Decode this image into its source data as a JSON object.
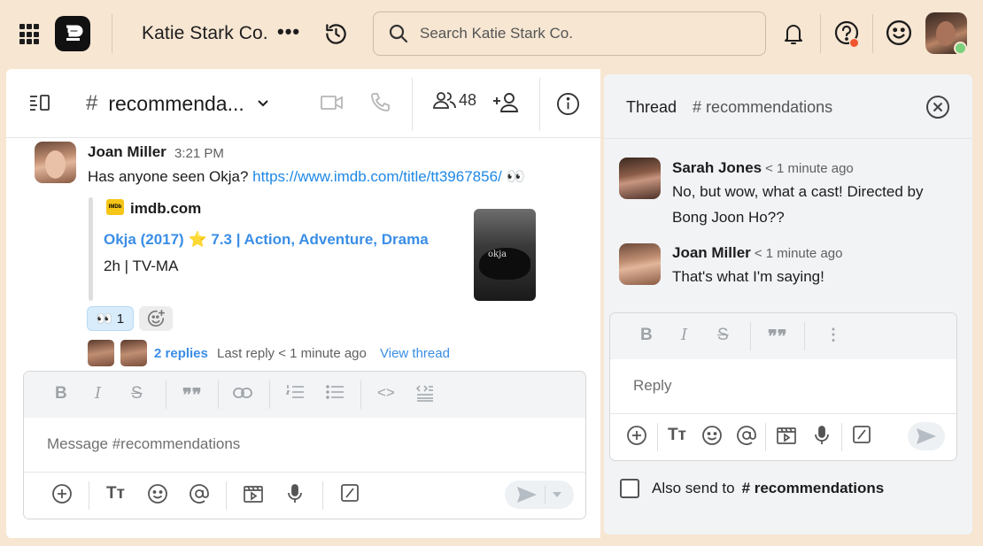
{
  "topbar": {
    "workspace_name": "Katie Stark Co.",
    "more_label": "•••",
    "search_placeholder": "Search Katie Stark Co."
  },
  "channel": {
    "hash": "#",
    "name": "recommenda...",
    "member_count": "48"
  },
  "message": {
    "author": "Joan Miller",
    "time": "3:21 PM",
    "text": "Has anyone seen Okja? ",
    "link": "https://www.imdb.com/title/tt3967856/",
    "emoji": " 👀",
    "preview": {
      "badge": "IMDb",
      "site": "imdb.com",
      "title": "Okja (2017) ⭐ 7.3 | Action, Adventure, Drama",
      "meta": "2h | TV-MA",
      "poster_title": "okja"
    },
    "reaction": {
      "emoji": "👀",
      "count": "1"
    },
    "replies": {
      "count_label": "2 replies",
      "last_reply": "Last reply < 1 minute ago",
      "view_thread": "View thread"
    }
  },
  "composer": {
    "placeholder": "Message #recommendations"
  },
  "thread": {
    "title": "Thread",
    "channel": "# recommendations",
    "messages": [
      {
        "author": "Sarah Jones",
        "time": "< 1 minute ago",
        "text": "No, but wow, what a cast! Directed by Bong Joon Ho??"
      },
      {
        "author": "Joan Miller",
        "time": "< 1 minute ago",
        "text": "That's what I'm saying!"
      }
    ],
    "reply_placeholder": "Reply",
    "also_send_label": "Also send to",
    "also_send_channel": "# recommendations"
  },
  "colors": {
    "background": "#f6e6d2",
    "link": "#3a8ee6",
    "notification_dot": "#f2542d",
    "online": "#7bd07b"
  }
}
